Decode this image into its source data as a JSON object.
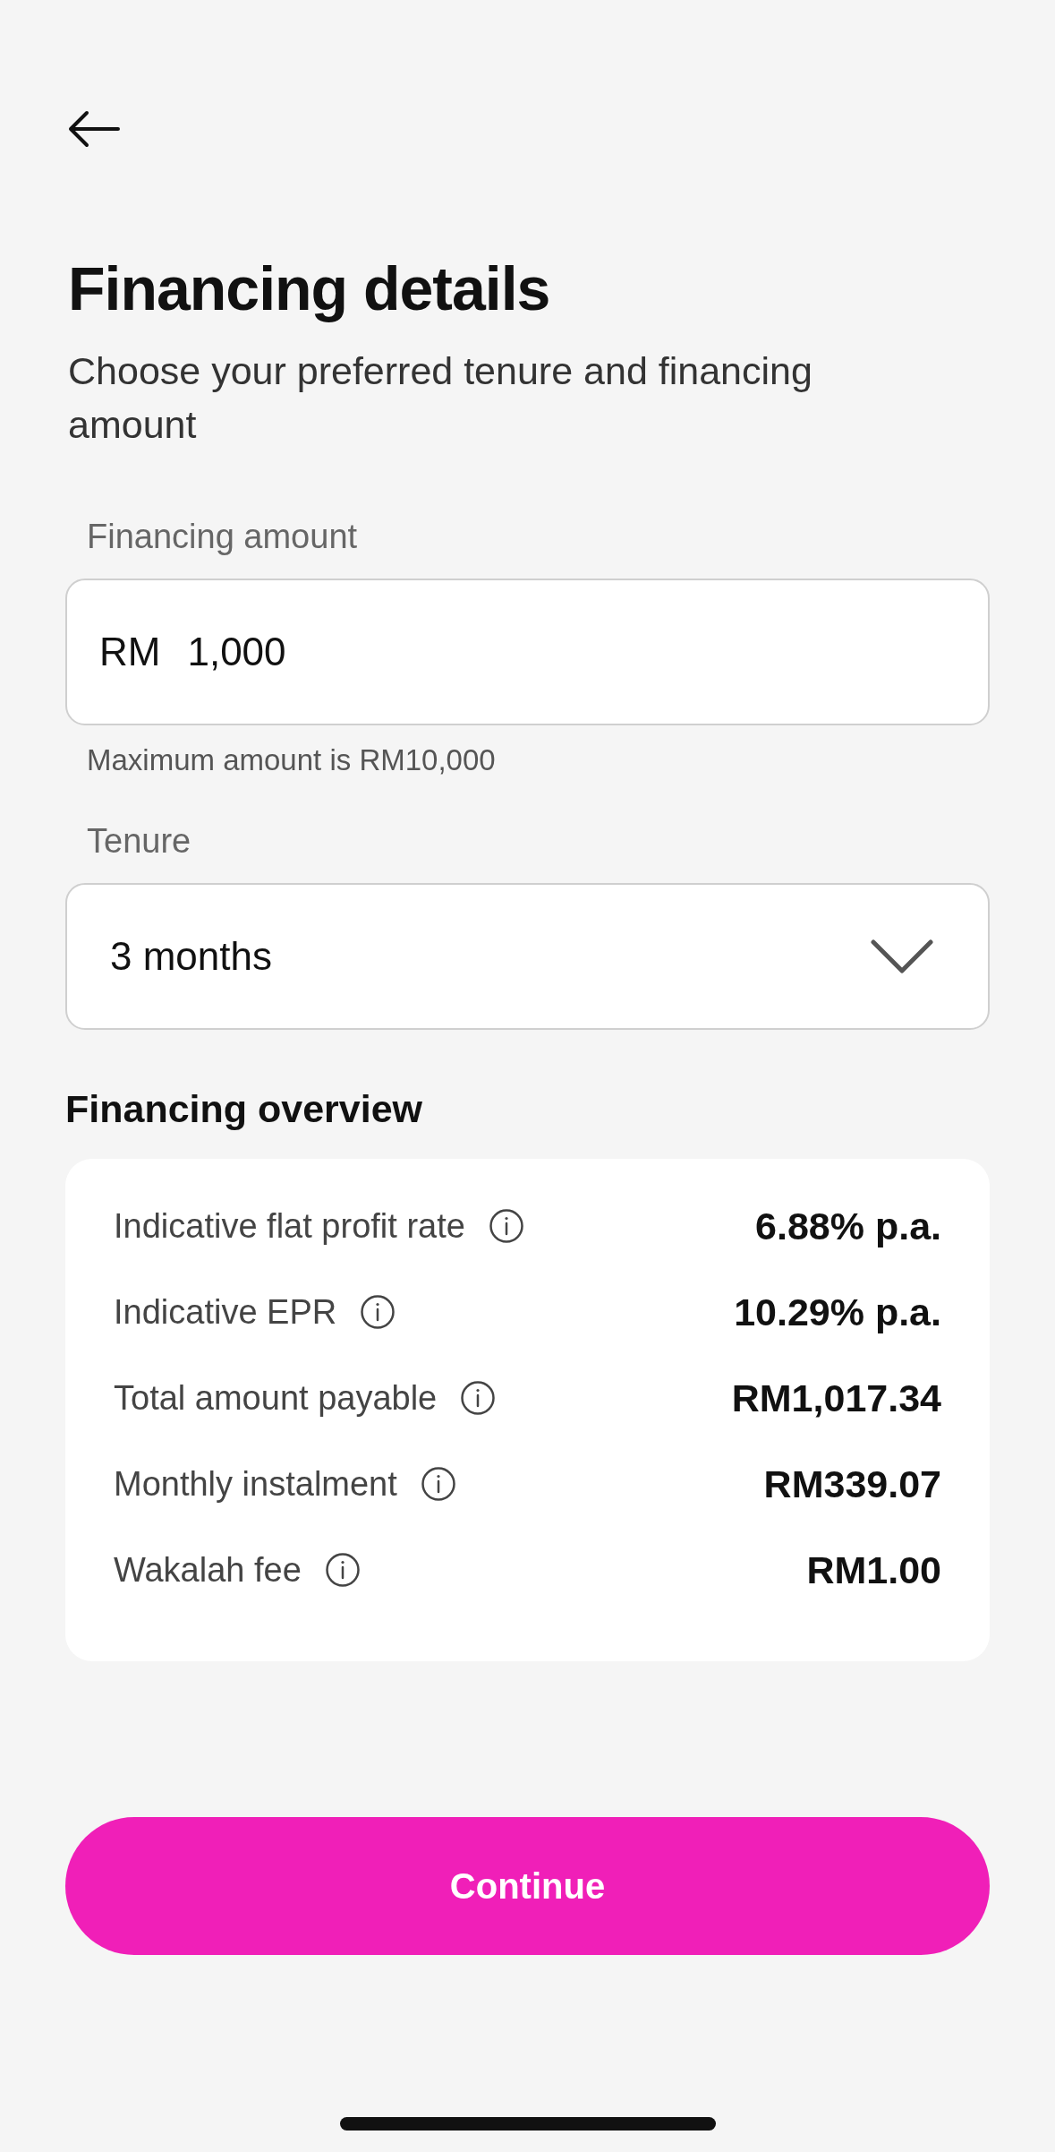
{
  "title": "Financing details",
  "subtitle": "Choose your preferred tenure and financing amount",
  "amount_field": {
    "label": "Financing amount",
    "prefix": "RM",
    "value": "1,000",
    "helper": "Maximum amount is RM10,000"
  },
  "tenure_field": {
    "label": "Tenure",
    "value": "3 months"
  },
  "overview": {
    "title": "Financing overview",
    "rows": [
      {
        "label": "Indicative flat profit rate",
        "value": "6.88% p.a."
      },
      {
        "label": "Indicative EPR",
        "value": "10.29% p.a."
      },
      {
        "label": "Total amount payable",
        "value": "RM1,017.34"
      },
      {
        "label": "Monthly instalment",
        "value": "RM339.07"
      },
      {
        "label": "Wakalah fee",
        "value": "RM1.00"
      }
    ]
  },
  "button": "Continue"
}
